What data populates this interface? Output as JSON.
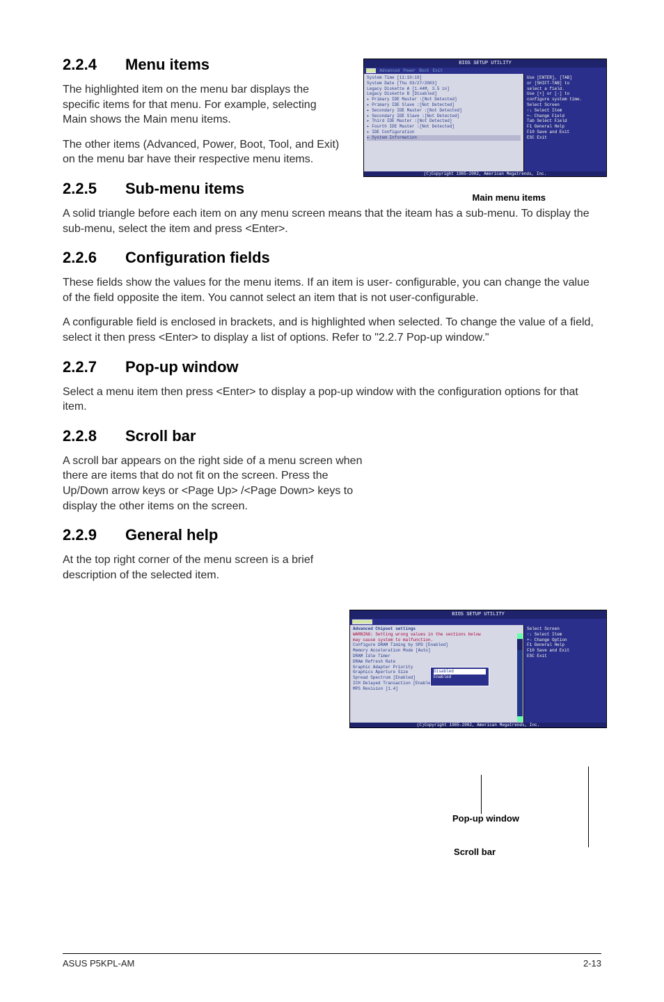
{
  "sections": {
    "s224": {
      "num": "2.2.4",
      "title": "Menu items",
      "p1": "The highlighted item on the menu bar displays the specific items for that menu. For example, selecting Main shows the Main menu items.",
      "p2": "The other items (Advanced, Power, Boot, Tool, and Exit) on the menu bar have their respective menu items."
    },
    "s225": {
      "num": "2.2.5",
      "title": "Sub-menu items",
      "p1": "A solid triangle before each item on any menu screen means that the iteam has a sub-menu. To display the sub-menu, select the item and press <Enter>."
    },
    "s226": {
      "num": "2.2.6",
      "title": "Configuration fields",
      "p1": "These fields show the values for the menu items. If an item is user- configurable, you can change the value of the field opposite the item. You cannot select an item that is not user-configurable.",
      "p2": "A configurable field is enclosed in brackets, and is highlighted when selected. To change the value of a field, select it then press <Enter> to display a list of options. Refer to \"2.2.7 Pop-up window.\""
    },
    "s227": {
      "num": "2.2.7",
      "title": "Pop-up window",
      "p1": "Select a menu item then press <Enter> to display a pop-up window with the configuration options for that item."
    },
    "s228": {
      "num": "2.2.8",
      "title": "Scroll bar",
      "p1": "A scroll bar appears on the right side of a menu screen when there are items that do not fit on the screen. Press the",
      "p2": "Up/Down arrow keys or <Page Up> /<Page Down> keys to display the other items on the screen."
    },
    "s229": {
      "num": "2.2.9",
      "title": "General help",
      "p1": "At the top right corner of the menu screen is a brief description of the selected item."
    }
  },
  "captions": {
    "main_menu": "Main menu items",
    "popup": "Pop-up window",
    "scrollbar": "Scroll bar"
  },
  "bios1": {
    "title": "BIOS SETUP UTILITY",
    "menu": [
      "Main",
      "Advanced",
      "Power",
      "Boot",
      "Exit"
    ],
    "rows": [
      "System Time            [11:10:19]",
      "System Date            [Thu 03/27/2003]",
      "Legacy Diskette A      [1.44M, 3.5 in]",
      "Legacy Diskette B      [Disabled]",
      "",
      "▸ Primary IDE Master   :[Not Detected]",
      "▸ Primary IDE Slave    :[Not Detected]",
      "▸ Secondary IDE Master :[Not Detected]",
      "▸ Secondary IDE Slave  :[Not Detected]",
      "▸ Third IDE Master     :[Not Detected]",
      "▸ Fourth IDE Master    :[Not Detected]",
      "▸ IDE Configuration",
      "",
      "▸ System Information"
    ],
    "help": [
      "Use [ENTER], [TAB]",
      "or [SHIFT-TAB] to",
      "select a field.",
      "",
      "Use [+] or [-] to",
      "configure system time.",
      "",
      "",
      "",
      "    Select Screen",
      "↑↓  Select Item",
      "+-  Change Field",
      "Tab Select Field",
      "F1  General Help",
      "F10 Save and Exit",
      "ESC Exit"
    ],
    "footer": "(C)Copyright 1985-2002, American Megatrends, Inc."
  },
  "bios2": {
    "title": "BIOS SETUP UTILITY",
    "menu_active": "Advanced",
    "heading": "Advanced Chipset settings",
    "warning": "WARNING: Setting wrong values in the sections below\n         may cause system to malfunction.",
    "rows": [
      "Configure DRAM Timing by SPD   [Enabled]",
      "Memory Acceleration Mode       [Auto]",
      "DRAM Idle Timer",
      "DRAm Refresh Rate",
      "",
      "Graphic Adapter Priority",
      "Graphics Aperture Size",
      "Spread Spectrum               [Enabled]",
      "",
      "ICH Delayed Transaction        [Enabled]",
      "",
      "MPS Revision                   [1.4]"
    ],
    "popup": [
      "Disabled",
      "Enabled"
    ],
    "help": [
      "",
      "",
      "",
      "",
      "",
      "",
      "",
      "    Select Screen",
      "↑↓  Select Item",
      "+-  Change Option",
      "F1  General Help",
      "F10 Save and Exit",
      "ESC Exit"
    ],
    "footer": "(C)Copyright 1985-2002, American Megatrends, Inc."
  },
  "footer": {
    "left": "ASUS P5KPL-AM",
    "right": "2-13"
  }
}
